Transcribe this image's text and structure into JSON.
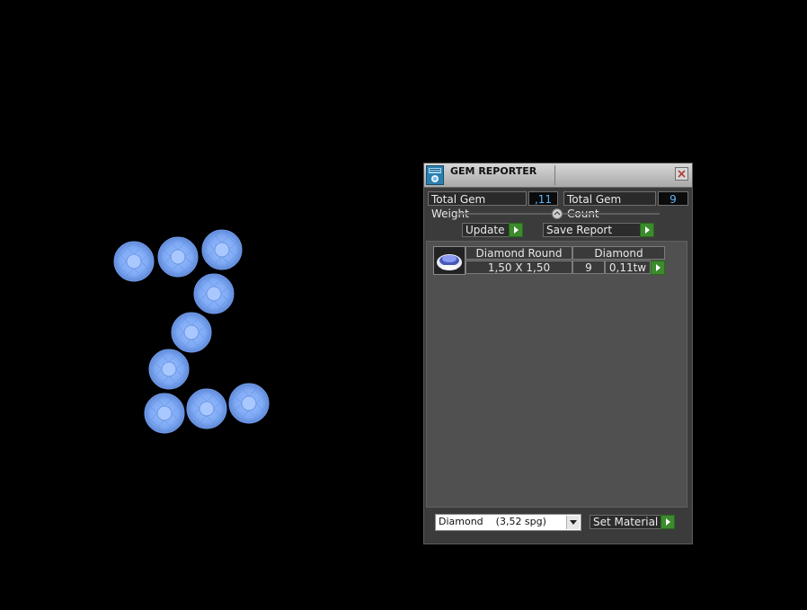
{
  "viewport": {
    "gem_shape": "round-diamond",
    "gem_color": "#8ab4ff",
    "gem_count": 9
  },
  "window": {
    "title": "GEM REPORTER",
    "icons": {
      "app": "gem-reporter-app-icon",
      "close": "close-icon"
    }
  },
  "stats": {
    "weight_label": "Total Gem Weight",
    "weight_value": ",11",
    "count_label": "Total Gem Count",
    "count_value": "9"
  },
  "buttons": {
    "update": "Update",
    "save_report": "Save Report",
    "set_material": "Set Material"
  },
  "report": {
    "headers": [
      "Diamond Round",
      "Diamond"
    ],
    "row": {
      "size": "1,50 X 1,50",
      "count": "9",
      "weight": "0,11tw"
    }
  },
  "material": {
    "selected": "Diamond    (3,52 spg)"
  },
  "colors": {
    "panel_bg": "#3b3b3b",
    "list_bg": "#505050",
    "value_text": "#58b6ff",
    "play_green": "#3c8b2d"
  }
}
